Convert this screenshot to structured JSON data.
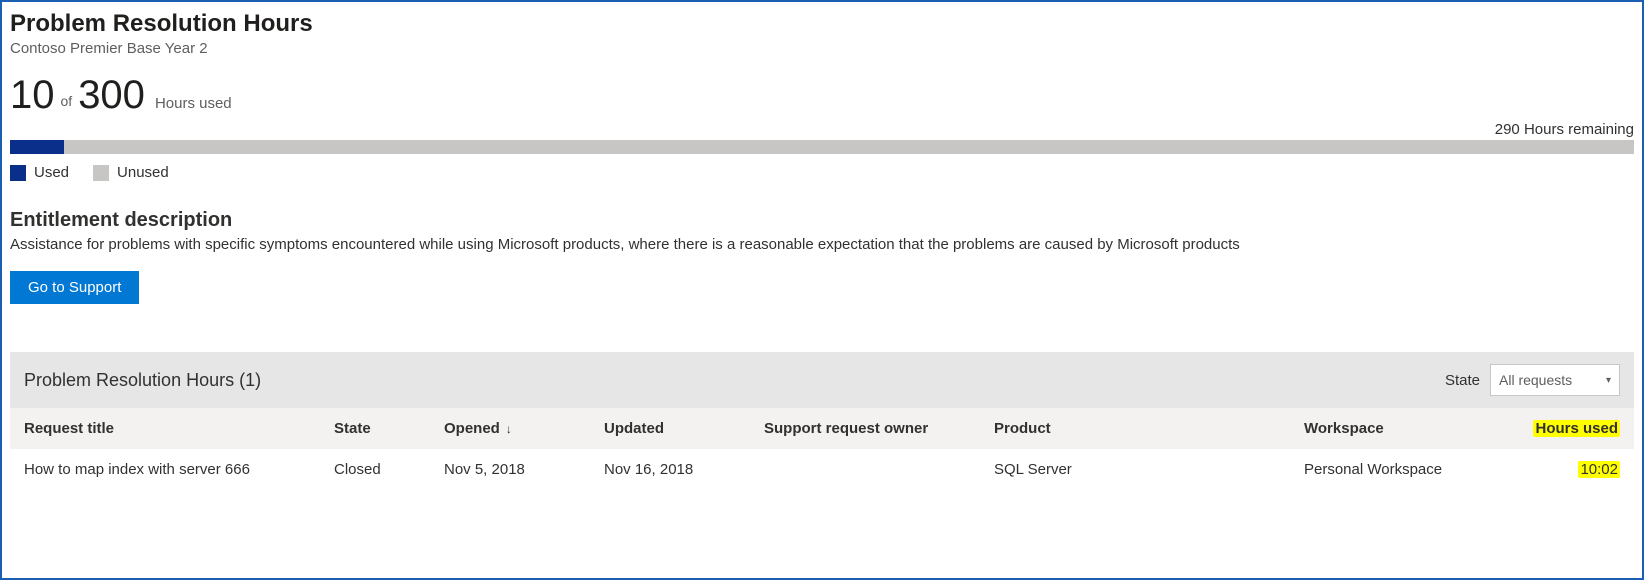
{
  "header": {
    "title": "Problem Resolution Hours",
    "subtitle": "Contoso Premier Base Year 2"
  },
  "usage": {
    "used": "10",
    "of_label": "of",
    "total": "300",
    "used_label": "Hours used",
    "remaining_text": "290 Hours remaining",
    "fill_percent": 3.3
  },
  "legend": {
    "used": "Used",
    "unused": "Unused"
  },
  "entitlement": {
    "title": "Entitlement description",
    "desc": "Assistance for problems with specific symptoms encountered while using Microsoft products, where there is a reasonable expectation that the problems are caused by Microsoft products",
    "button": "Go to Support"
  },
  "table": {
    "bar_title": "Problem Resolution Hours (1)",
    "state_label": "State",
    "state_selected": "All requests",
    "columns": {
      "request_title": "Request title",
      "state": "State",
      "opened": "Opened",
      "updated": "Updated",
      "owner": "Support request owner",
      "product": "Product",
      "workspace": "Workspace",
      "hours_used": "Hours used"
    },
    "rows": [
      {
        "request_title": "How to map index with server 666",
        "state": "Closed",
        "opened": "Nov 5, 2018",
        "updated": "Nov 16, 2018",
        "owner": "",
        "product": "SQL Server",
        "workspace": "Personal Workspace",
        "hours_used": "10:02"
      }
    ]
  }
}
